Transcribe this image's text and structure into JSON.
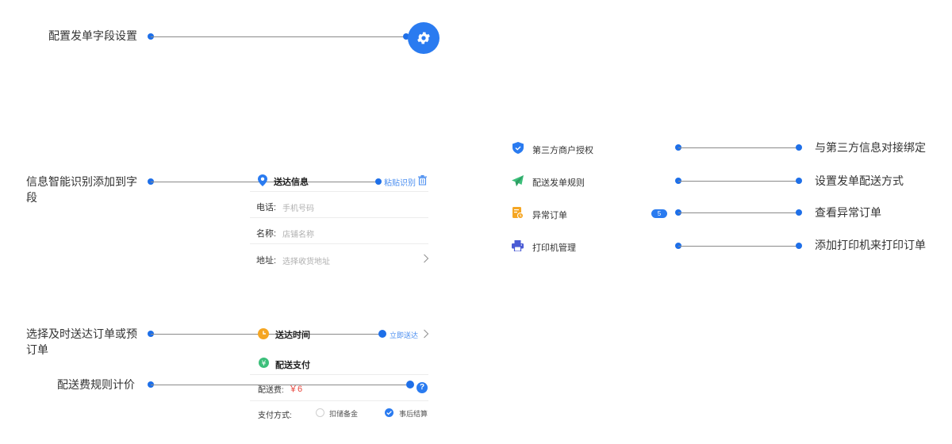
{
  "annotations": {
    "field_settings": "配置发单字段设置",
    "smart_recognition": "信息智能识别添加到字段",
    "delivery_time": "选择及时送达订单或预订单",
    "fee_rules": "配送费规则计价",
    "third_party": "与第三方信息对接绑定",
    "dispatch_mode": "设置发单配送方式",
    "abnormal_orders": "查看异常订单",
    "printer": "添加打印机来打印订单"
  },
  "delivery_info": {
    "title": "送达信息",
    "paste_label": "粘贴识别",
    "fields": [
      {
        "label": "电话:",
        "placeholder": "手机号码"
      },
      {
        "label": "名称:",
        "placeholder": "店铺名称"
      },
      {
        "label": "地址:",
        "placeholder": "选择收货地址"
      }
    ]
  },
  "delivery_time": {
    "title": "送达时间",
    "value": "立即送达"
  },
  "payment": {
    "title": "配送支付",
    "fee_label": "配送费:",
    "fee_value": "￥6",
    "method_label": "支付方式:",
    "options": [
      {
        "label": "扣储备金",
        "selected": false
      },
      {
        "label": "事后结算",
        "selected": true
      }
    ]
  },
  "menu": [
    {
      "label": "第三方商户授权",
      "icon": "shield-icon"
    },
    {
      "label": "配送发单规则",
      "icon": "paper-plane-icon"
    },
    {
      "label": "异常订单",
      "icon": "abnormal-order-icon",
      "badge": "5"
    },
    {
      "label": "打印机管理",
      "icon": "printer-icon"
    }
  ],
  "colors": {
    "accent": "#1e6fe8",
    "shield": "#2a7bf0",
    "plane": "#3cbf7a",
    "order": "#f5a623",
    "printer": "#4a5bd4",
    "fee": "#e8453c"
  }
}
